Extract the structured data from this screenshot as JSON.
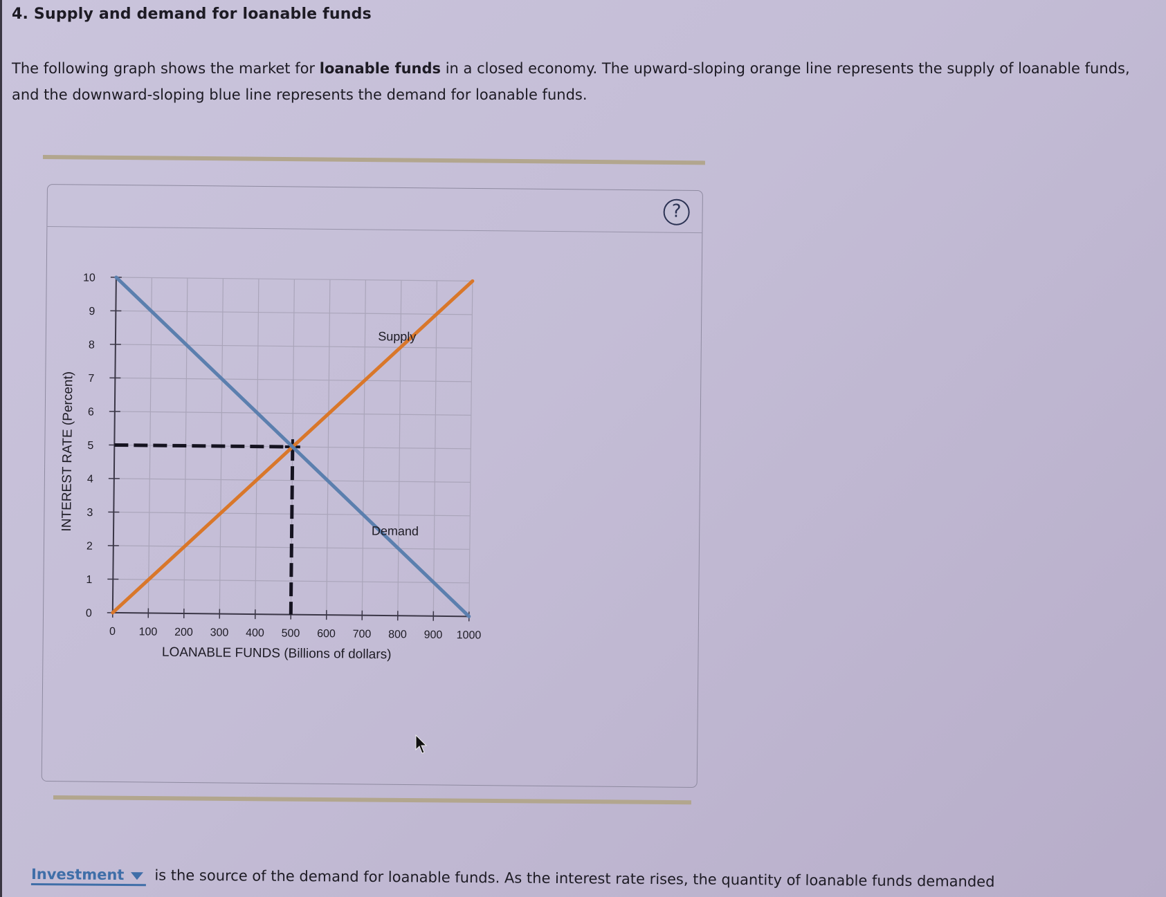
{
  "question": {
    "title": "4. Supply and demand for loanable funds",
    "intro_part1": "The following graph shows the market for ",
    "intro_bold": "loanable funds",
    "intro_part2": " in a closed economy. The upward-sloping orange line represents the supply of loanable funds, and the downward-sloping blue line represents the demand for loanable funds."
  },
  "panel": {
    "help_label": "?"
  },
  "colors": {
    "supply": "#d9772a",
    "demand": "#5b7fae",
    "dashed": "#151320",
    "grid": "#aaa5ba",
    "axis": "#3a3646",
    "link": "#3f6ea8"
  },
  "chart_data": {
    "type": "line",
    "title": "",
    "xlabel": "LOANABLE FUNDS (Billions of dollars)",
    "ylabel": "INTEREST RATE (Percent)",
    "xlim": [
      0,
      1000
    ],
    "ylim": [
      0,
      10
    ],
    "x_ticks": [
      0,
      100,
      200,
      300,
      400,
      500,
      600,
      700,
      800,
      900,
      1000
    ],
    "y_ticks": [
      0,
      1,
      2,
      3,
      4,
      5,
      6,
      7,
      8,
      9,
      10
    ],
    "grid": true,
    "series": [
      {
        "name": "Supply",
        "label": "Supply",
        "color": "#d9772a",
        "points": [
          [
            0,
            0
          ],
          [
            1000,
            10
          ]
        ]
      },
      {
        "name": "Demand",
        "label": "Demand",
        "color": "#5b7fae",
        "points": [
          [
            0,
            10
          ],
          [
            1000,
            0
          ]
        ]
      }
    ],
    "equilibrium": {
      "x": 500,
      "y": 5
    },
    "annotations": [
      {
        "text": "Supply",
        "x": 790,
        "y": 8.2
      },
      {
        "text": "Demand",
        "x": 790,
        "y": 2.4
      }
    ]
  },
  "bottom": {
    "dropdown_value": "Investment",
    "sentence": "is the source of the demand for loanable funds. As the interest rate rises, the quantity of loanable funds demanded"
  }
}
